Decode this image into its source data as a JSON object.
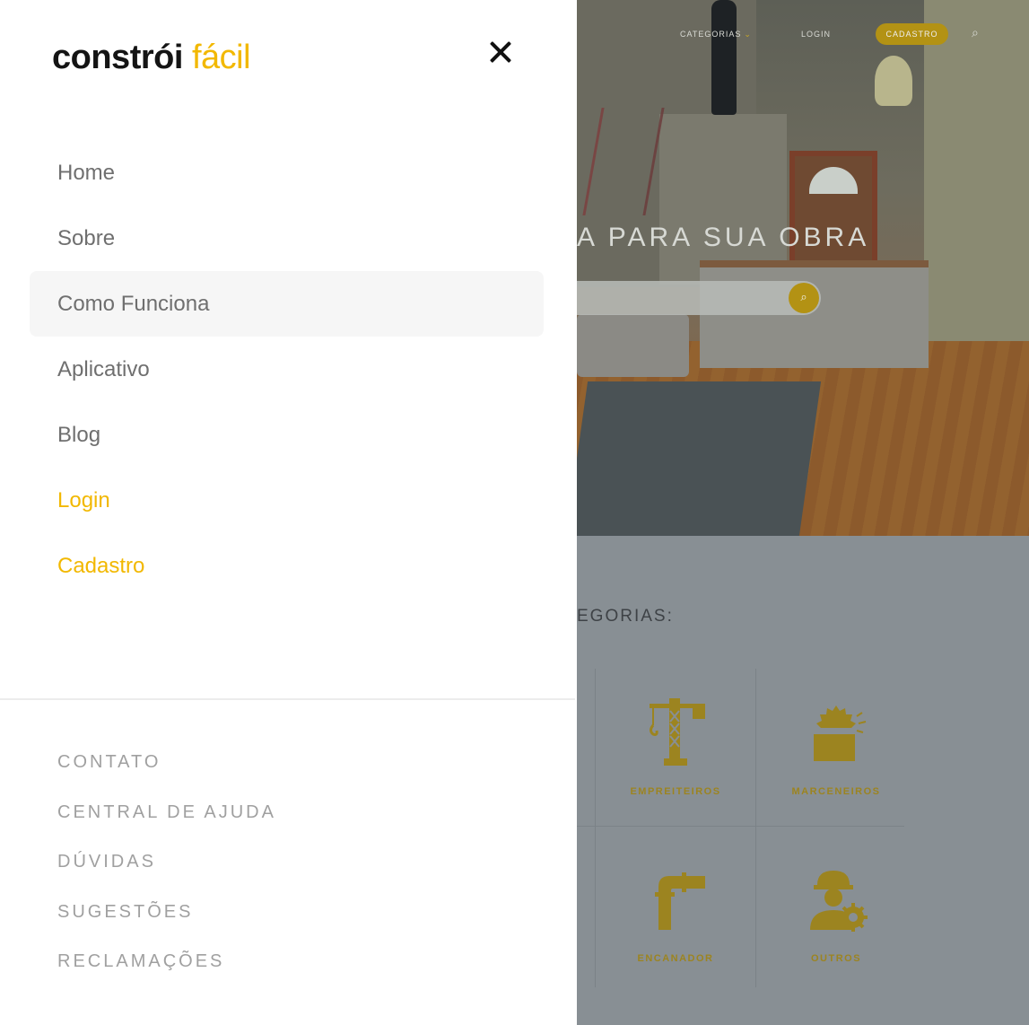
{
  "drawer": {
    "logo": {
      "part1": "constrói",
      "part2": "fácil"
    },
    "menu": [
      {
        "label": "Home"
      },
      {
        "label": "Sobre"
      },
      {
        "label": "Como Funciona"
      },
      {
        "label": "Aplicativo"
      },
      {
        "label": "Blog"
      },
      {
        "label": "Login"
      },
      {
        "label": "Cadastro"
      }
    ],
    "footer_links": [
      {
        "label": "CONTATO"
      },
      {
        "label": "CENTRAL DE AJUDA"
      },
      {
        "label": "DÚVIDAS"
      },
      {
        "label": "SUGESTÕES"
      },
      {
        "label": "RECLAMAÇÕES"
      }
    ]
  },
  "background_page": {
    "nav": {
      "categorias": "CATEGORIAS",
      "login": "LOGIN",
      "cadastro": "CADASTRO"
    },
    "hero_title": "A PARA SUA OBRA",
    "categories_title": "EGORIAS:",
    "categories": [
      {
        "label": "EMPREITEIROS",
        "icon": "crane-icon"
      },
      {
        "label": "MARCENEIROS",
        "icon": "saw-icon"
      },
      {
        "label": "ENCANADOR",
        "icon": "pipe-icon"
      },
      {
        "label": "OUTROS",
        "icon": "worker-gear-icon"
      }
    ]
  },
  "colors": {
    "accent": "#f2b800",
    "overlay_accent": "#b39214",
    "menu_text": "#6f6f6f",
    "footer_text": "#a0a0a0"
  }
}
